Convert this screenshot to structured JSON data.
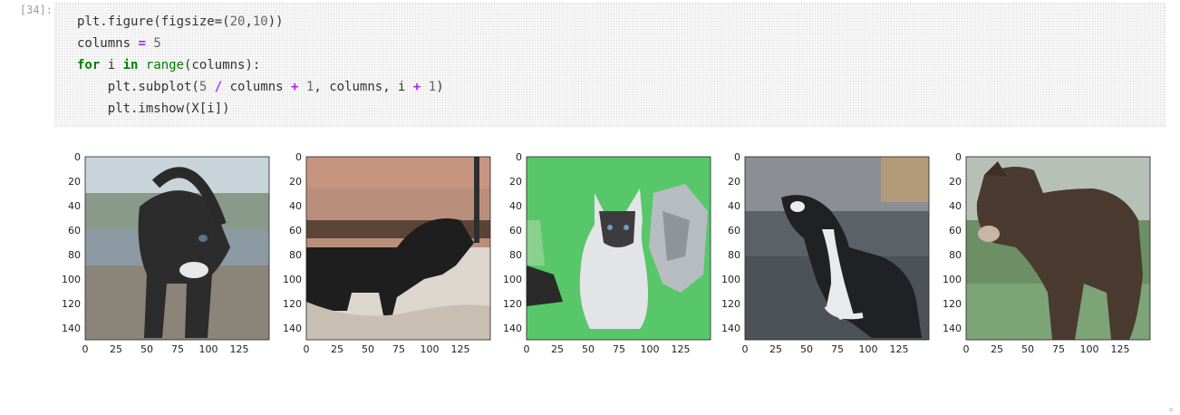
{
  "cell": {
    "prompt": "[34]:",
    "code_lines": [
      "plt.figure(figsize=(20,10))",
      "columns = 5",
      "for i in range(columns):",
      "    plt.subplot(5 / columns + 1, columns, i + 1)",
      "    plt.imshow(X[i])"
    ]
  },
  "chart_data": [
    {
      "type": "image",
      "description_key": "dog-dark",
      "xticks": [
        "0",
        "25",
        "50",
        "75",
        "100",
        "125"
      ],
      "yticks": [
        "0",
        "20",
        "40",
        "60",
        "80",
        "100",
        "120",
        "140"
      ],
      "xlim": [
        0,
        150
      ],
      "ylim": [
        150,
        0
      ]
    },
    {
      "type": "image",
      "description_key": "dog-silhouette-snow",
      "xticks": [
        "0",
        "25",
        "50",
        "75",
        "100",
        "125"
      ],
      "yticks": [
        "0",
        "20",
        "40",
        "60",
        "80",
        "100",
        "120",
        "140"
      ],
      "xlim": [
        0,
        150
      ],
      "ylim": [
        150,
        0
      ]
    },
    {
      "type": "image",
      "description_key": "siamese-cat-green",
      "xticks": [
        "0",
        "25",
        "50",
        "75",
        "100",
        "125"
      ],
      "yticks": [
        "0",
        "20",
        "40",
        "60",
        "80",
        "100",
        "120",
        "140"
      ],
      "xlim": [
        0,
        150
      ],
      "ylim": [
        150,
        0
      ]
    },
    {
      "type": "image",
      "description_key": "black-white-dog",
      "xticks": [
        "0",
        "25",
        "50",
        "75",
        "100",
        "125"
      ],
      "yticks": [
        "0",
        "20",
        "40",
        "60",
        "80",
        "100",
        "120",
        "140"
      ],
      "xlim": [
        0,
        150
      ],
      "ylim": [
        150,
        0
      ]
    },
    {
      "type": "image",
      "description_key": "brown-dog-grass",
      "xticks": [
        "0",
        "25",
        "50",
        "75",
        "100",
        "125"
      ],
      "yticks": [
        "0",
        "20",
        "40",
        "60",
        "80",
        "100",
        "120",
        "140"
      ],
      "xlim": [
        0,
        150
      ],
      "ylim": [
        150,
        0
      ]
    }
  ],
  "colors": {
    "cell_bg": "#f7f7f7",
    "keyword": "#008000",
    "operator": "#aa22ff",
    "number": "#666666",
    "prompt": "#9e9e9e"
  }
}
